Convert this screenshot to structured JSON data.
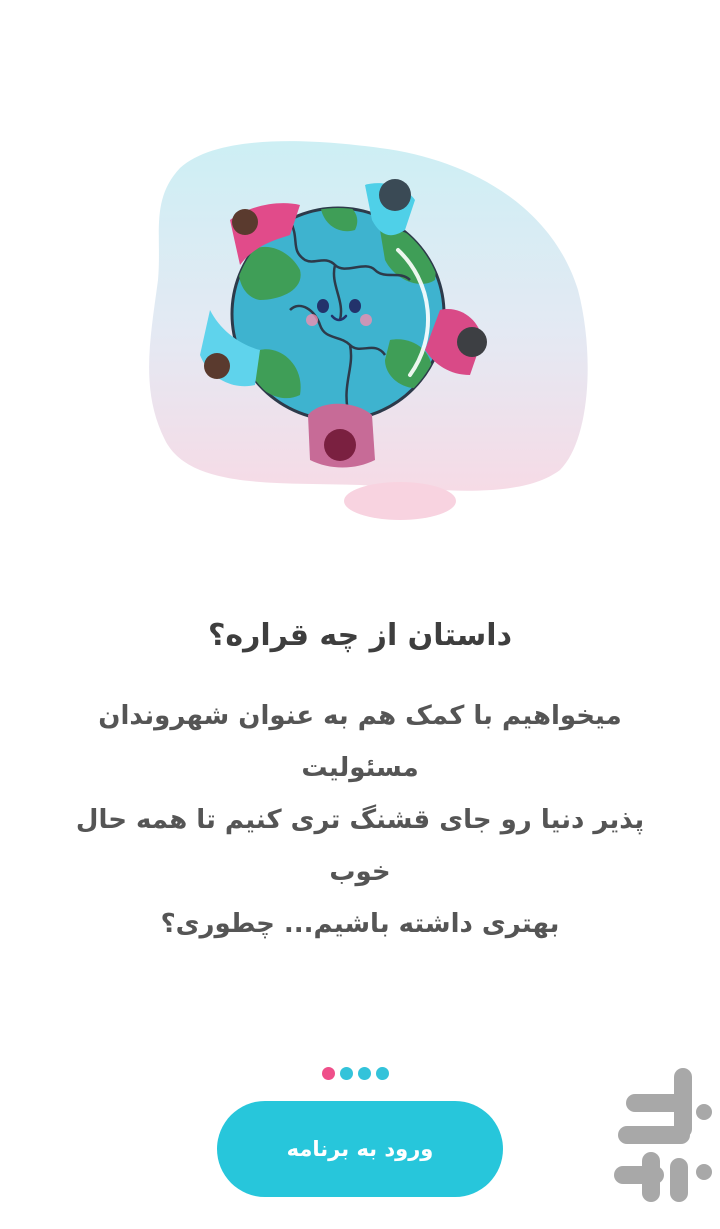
{
  "intro": {
    "title": "داستان از چه قراره؟",
    "body_lines": [
      "میخواهیم با کمک هم به عنوان شهروندان مسئولیت",
      "پذیر دنیا رو جای قشنگ تری کنیم تا همه حال خوب",
      "بهتری داشته باشیم... چطوری؟"
    ]
  },
  "pager": {
    "total": 4,
    "active_index": 0
  },
  "enter_button": {
    "label": "ورود به برنامه"
  },
  "colors": {
    "accent": "#27c6db",
    "active_dot": "#ef4f8a",
    "inactive_dot": "#33c3da",
    "title": "#3e3e3e",
    "body": "#555555"
  },
  "illustration": {
    "icon": "globe-puzzle-people-illustration"
  }
}
